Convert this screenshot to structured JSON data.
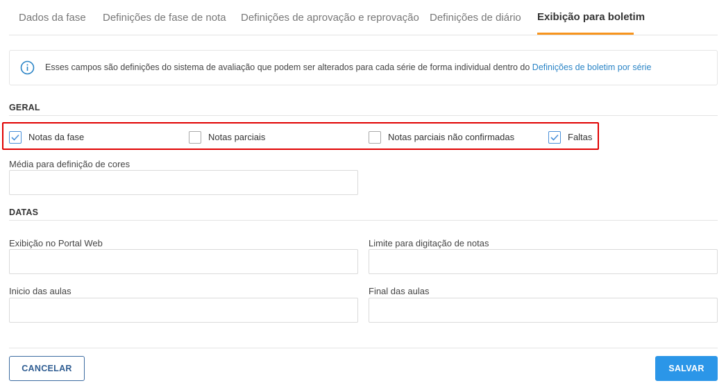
{
  "tabs": [
    {
      "label": "Dados da fase"
    },
    {
      "label": "Definições de fase de nota"
    },
    {
      "label": "Definições de aprovação e reprovação"
    },
    {
      "label": "Definições de diário"
    },
    {
      "label": "Exibição para boletim",
      "active": true
    }
  ],
  "info": {
    "text": "Esses campos são definições do sistema de avaliação que podem ser alterados para cada série de forma individual dentro do ",
    "link": "Definições de boletim por série",
    "icon": "info-circle-icon"
  },
  "geral": {
    "title": "GERAL",
    "checkboxes": [
      {
        "label": "Notas da fase",
        "checked": true
      },
      {
        "label": "Notas parciais",
        "checked": false
      },
      {
        "label": "Notas parciais não confirmadas",
        "checked": false
      },
      {
        "label": "Faltas",
        "checked": true
      }
    ],
    "media_label": "Média para definição de cores",
    "media_value": ""
  },
  "datas": {
    "title": "DATAS",
    "portal_label": "Exibição no Portal Web",
    "limite_label": "Limite para digitação de notas",
    "inicio_label": "Inicio das aulas",
    "final_label": "Final das aulas"
  },
  "actions": {
    "cancel": "CANCELAR",
    "save": "SALVAR"
  },
  "colors": {
    "accent_tab": "#f7941d",
    "link": "#2a84c6",
    "save_button": "#2b96e8",
    "highlight": "#e00000"
  }
}
